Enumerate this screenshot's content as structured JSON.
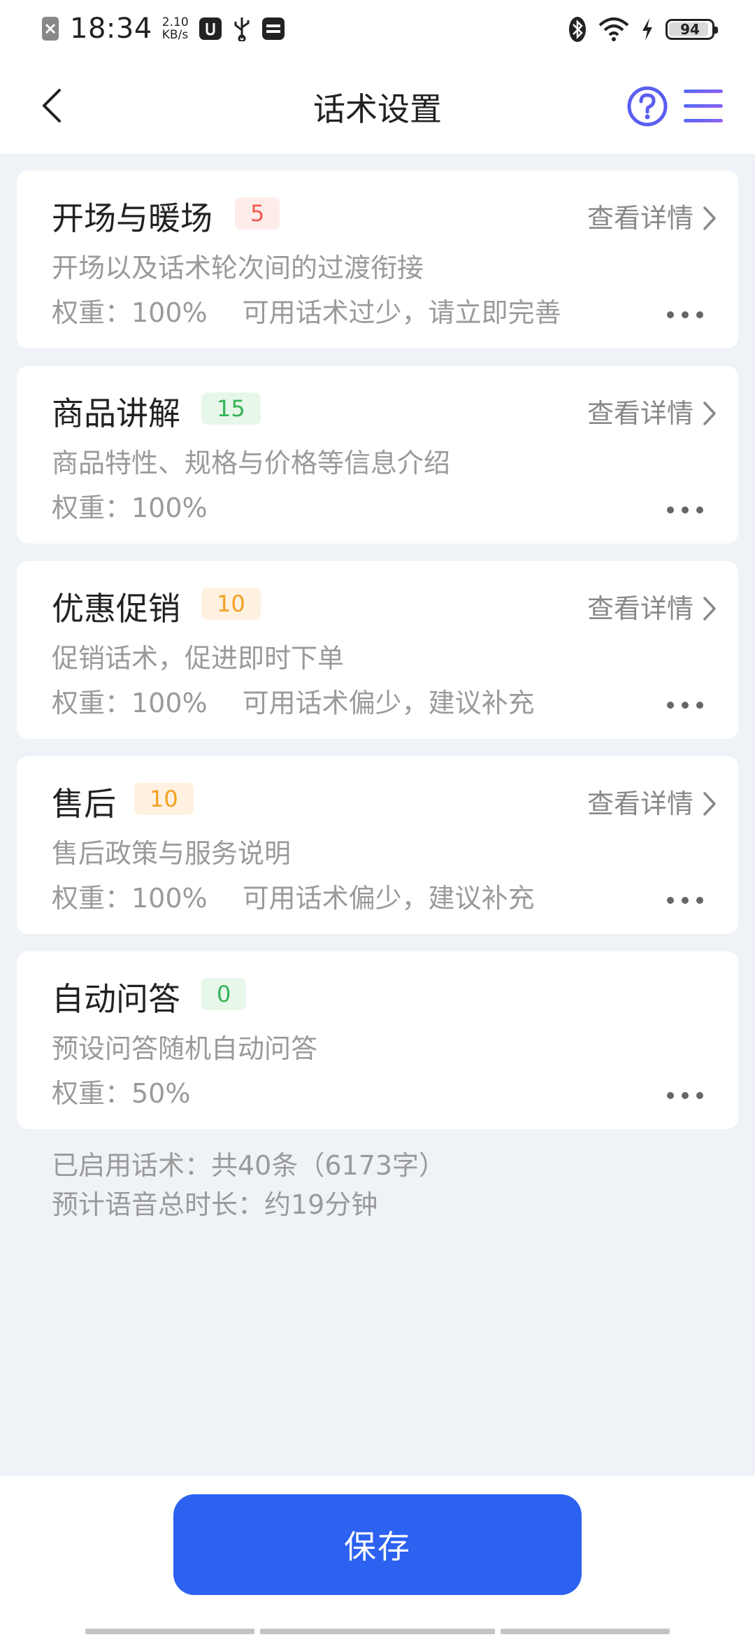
{
  "status_bar": {
    "time": "18:34",
    "net_speed_value": "2.10",
    "net_speed_unit": "KB/s",
    "battery_level": "94"
  },
  "header": {
    "title": "话术设置"
  },
  "cards": [
    {
      "title": "开场与暖场",
      "count": "5",
      "badge_color": "#f05a4a",
      "detail_label": "查看详情",
      "description": "开场以及话术轮次间的过渡衔接",
      "weight": "权重：100%",
      "warning": "可用话术过少，请立即完善",
      "show_detail": true
    },
    {
      "title": "商品讲解",
      "count": "15",
      "badge_color": "#33b455",
      "detail_label": "查看详情",
      "description": "商品特性、规格与价格等信息介绍",
      "weight": "权重：100%",
      "warning": "",
      "show_detail": true
    },
    {
      "title": "优惠促销",
      "count": "10",
      "badge_color": "#f3a020",
      "detail_label": "查看详情",
      "description": "促销话术，促进即时下单",
      "weight": "权重：100%",
      "warning": "可用话术偏少，建议补充",
      "show_detail": true
    },
    {
      "title": "售后",
      "count": "10",
      "badge_color": "#f3a020",
      "detail_label": "查看详情",
      "description": "售后政策与服务说明",
      "weight": "权重：100%",
      "warning": "可用话术偏少，建议补充",
      "show_detail": true
    },
    {
      "title": "自动问答",
      "count": "0",
      "badge_color": "#33b455",
      "detail_label": "",
      "description": "预设问答随机自动问答",
      "weight": "权重：50%",
      "warning": "",
      "show_detail": false
    }
  ],
  "summary": {
    "enabled": "已启用话术：共40条（6173字）",
    "duration": "预计语音总时长：约19分钟"
  },
  "footer": {
    "save_label": "保存"
  },
  "colors": {
    "accent": "#2d62f1",
    "background": "#eff3f8",
    "help_icon": "#5b5ef0"
  }
}
